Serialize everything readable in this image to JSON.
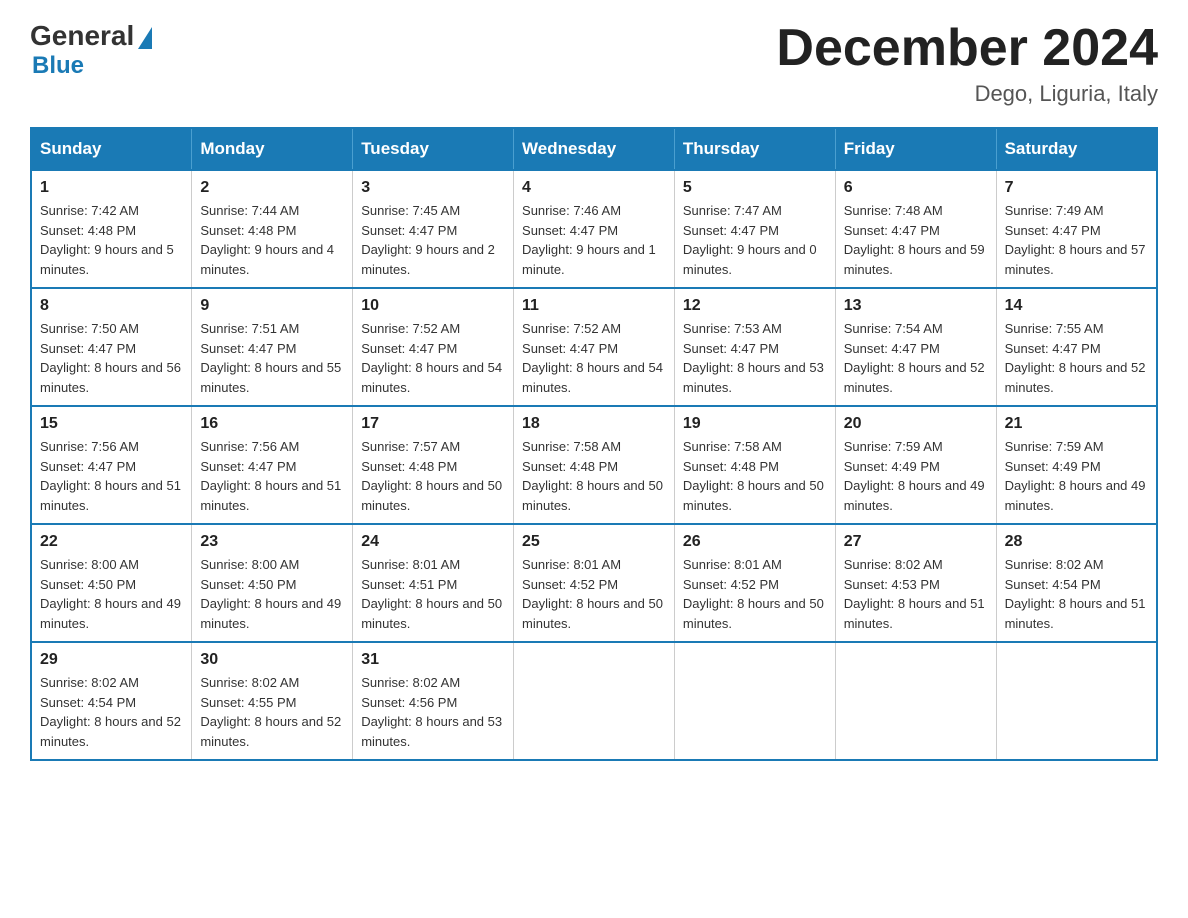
{
  "header": {
    "logo": {
      "general": "General",
      "blue": "Blue"
    },
    "title": "December 2024",
    "location": "Dego, Liguria, Italy"
  },
  "calendar": {
    "days_of_week": [
      "Sunday",
      "Monday",
      "Tuesday",
      "Wednesday",
      "Thursday",
      "Friday",
      "Saturday"
    ],
    "weeks": [
      [
        {
          "day": "1",
          "sunrise": "7:42 AM",
          "sunset": "4:48 PM",
          "daylight": "9 hours and 5 minutes."
        },
        {
          "day": "2",
          "sunrise": "7:44 AM",
          "sunset": "4:48 PM",
          "daylight": "9 hours and 4 minutes."
        },
        {
          "day": "3",
          "sunrise": "7:45 AM",
          "sunset": "4:47 PM",
          "daylight": "9 hours and 2 minutes."
        },
        {
          "day": "4",
          "sunrise": "7:46 AM",
          "sunset": "4:47 PM",
          "daylight": "9 hours and 1 minute."
        },
        {
          "day": "5",
          "sunrise": "7:47 AM",
          "sunset": "4:47 PM",
          "daylight": "9 hours and 0 minutes."
        },
        {
          "day": "6",
          "sunrise": "7:48 AM",
          "sunset": "4:47 PM",
          "daylight": "8 hours and 59 minutes."
        },
        {
          "day": "7",
          "sunrise": "7:49 AM",
          "sunset": "4:47 PM",
          "daylight": "8 hours and 57 minutes."
        }
      ],
      [
        {
          "day": "8",
          "sunrise": "7:50 AM",
          "sunset": "4:47 PM",
          "daylight": "8 hours and 56 minutes."
        },
        {
          "day": "9",
          "sunrise": "7:51 AM",
          "sunset": "4:47 PM",
          "daylight": "8 hours and 55 minutes."
        },
        {
          "day": "10",
          "sunrise": "7:52 AM",
          "sunset": "4:47 PM",
          "daylight": "8 hours and 54 minutes."
        },
        {
          "day": "11",
          "sunrise": "7:52 AM",
          "sunset": "4:47 PM",
          "daylight": "8 hours and 54 minutes."
        },
        {
          "day": "12",
          "sunrise": "7:53 AM",
          "sunset": "4:47 PM",
          "daylight": "8 hours and 53 minutes."
        },
        {
          "day": "13",
          "sunrise": "7:54 AM",
          "sunset": "4:47 PM",
          "daylight": "8 hours and 52 minutes."
        },
        {
          "day": "14",
          "sunrise": "7:55 AM",
          "sunset": "4:47 PM",
          "daylight": "8 hours and 52 minutes."
        }
      ],
      [
        {
          "day": "15",
          "sunrise": "7:56 AM",
          "sunset": "4:47 PM",
          "daylight": "8 hours and 51 minutes."
        },
        {
          "day": "16",
          "sunrise": "7:56 AM",
          "sunset": "4:47 PM",
          "daylight": "8 hours and 51 minutes."
        },
        {
          "day": "17",
          "sunrise": "7:57 AM",
          "sunset": "4:48 PM",
          "daylight": "8 hours and 50 minutes."
        },
        {
          "day": "18",
          "sunrise": "7:58 AM",
          "sunset": "4:48 PM",
          "daylight": "8 hours and 50 minutes."
        },
        {
          "day": "19",
          "sunrise": "7:58 AM",
          "sunset": "4:48 PM",
          "daylight": "8 hours and 50 minutes."
        },
        {
          "day": "20",
          "sunrise": "7:59 AM",
          "sunset": "4:49 PM",
          "daylight": "8 hours and 49 minutes."
        },
        {
          "day": "21",
          "sunrise": "7:59 AM",
          "sunset": "4:49 PM",
          "daylight": "8 hours and 49 minutes."
        }
      ],
      [
        {
          "day": "22",
          "sunrise": "8:00 AM",
          "sunset": "4:50 PM",
          "daylight": "8 hours and 49 minutes."
        },
        {
          "day": "23",
          "sunrise": "8:00 AM",
          "sunset": "4:50 PM",
          "daylight": "8 hours and 49 minutes."
        },
        {
          "day": "24",
          "sunrise": "8:01 AM",
          "sunset": "4:51 PM",
          "daylight": "8 hours and 50 minutes."
        },
        {
          "day": "25",
          "sunrise": "8:01 AM",
          "sunset": "4:52 PM",
          "daylight": "8 hours and 50 minutes."
        },
        {
          "day": "26",
          "sunrise": "8:01 AM",
          "sunset": "4:52 PM",
          "daylight": "8 hours and 50 minutes."
        },
        {
          "day": "27",
          "sunrise": "8:02 AM",
          "sunset": "4:53 PM",
          "daylight": "8 hours and 51 minutes."
        },
        {
          "day": "28",
          "sunrise": "8:02 AM",
          "sunset": "4:54 PM",
          "daylight": "8 hours and 51 minutes."
        }
      ],
      [
        {
          "day": "29",
          "sunrise": "8:02 AM",
          "sunset": "4:54 PM",
          "daylight": "8 hours and 52 minutes."
        },
        {
          "day": "30",
          "sunrise": "8:02 AM",
          "sunset": "4:55 PM",
          "daylight": "8 hours and 52 minutes."
        },
        {
          "day": "31",
          "sunrise": "8:02 AM",
          "sunset": "4:56 PM",
          "daylight": "8 hours and 53 minutes."
        },
        null,
        null,
        null,
        null
      ]
    ]
  }
}
